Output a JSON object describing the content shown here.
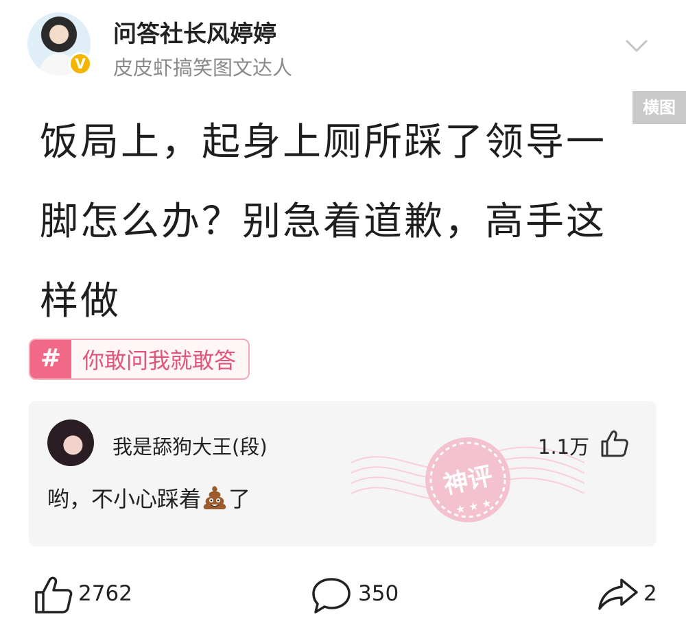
{
  "author": {
    "name": "问答社长风婷婷",
    "subtitle": "皮皮虾搞笑图文达人",
    "verified_badge": "V"
  },
  "badges": {
    "horizontal_label": "横图"
  },
  "post": {
    "title": "饭局上，起身上厕所踩了领导一脚怎么办？别急着道歉，高手这样做"
  },
  "topic": {
    "hash_symbol": "#",
    "label": "你敢问我就敢答"
  },
  "comment": {
    "username": "我是舔狗大王(段)",
    "likes": "1.1万",
    "text_before": "哟，不小心踩着",
    "emoji": "poop-emoji",
    "text_after": "了",
    "stamp_text": "神评"
  },
  "actions": {
    "like_count": "2762",
    "comment_count": "350",
    "share_count": "2"
  },
  "colors": {
    "accent_pink": "#f06a87",
    "topic_text": "#e2557a",
    "verified_gold": "#f5b400",
    "muted_gray": "#8a8a8a"
  }
}
